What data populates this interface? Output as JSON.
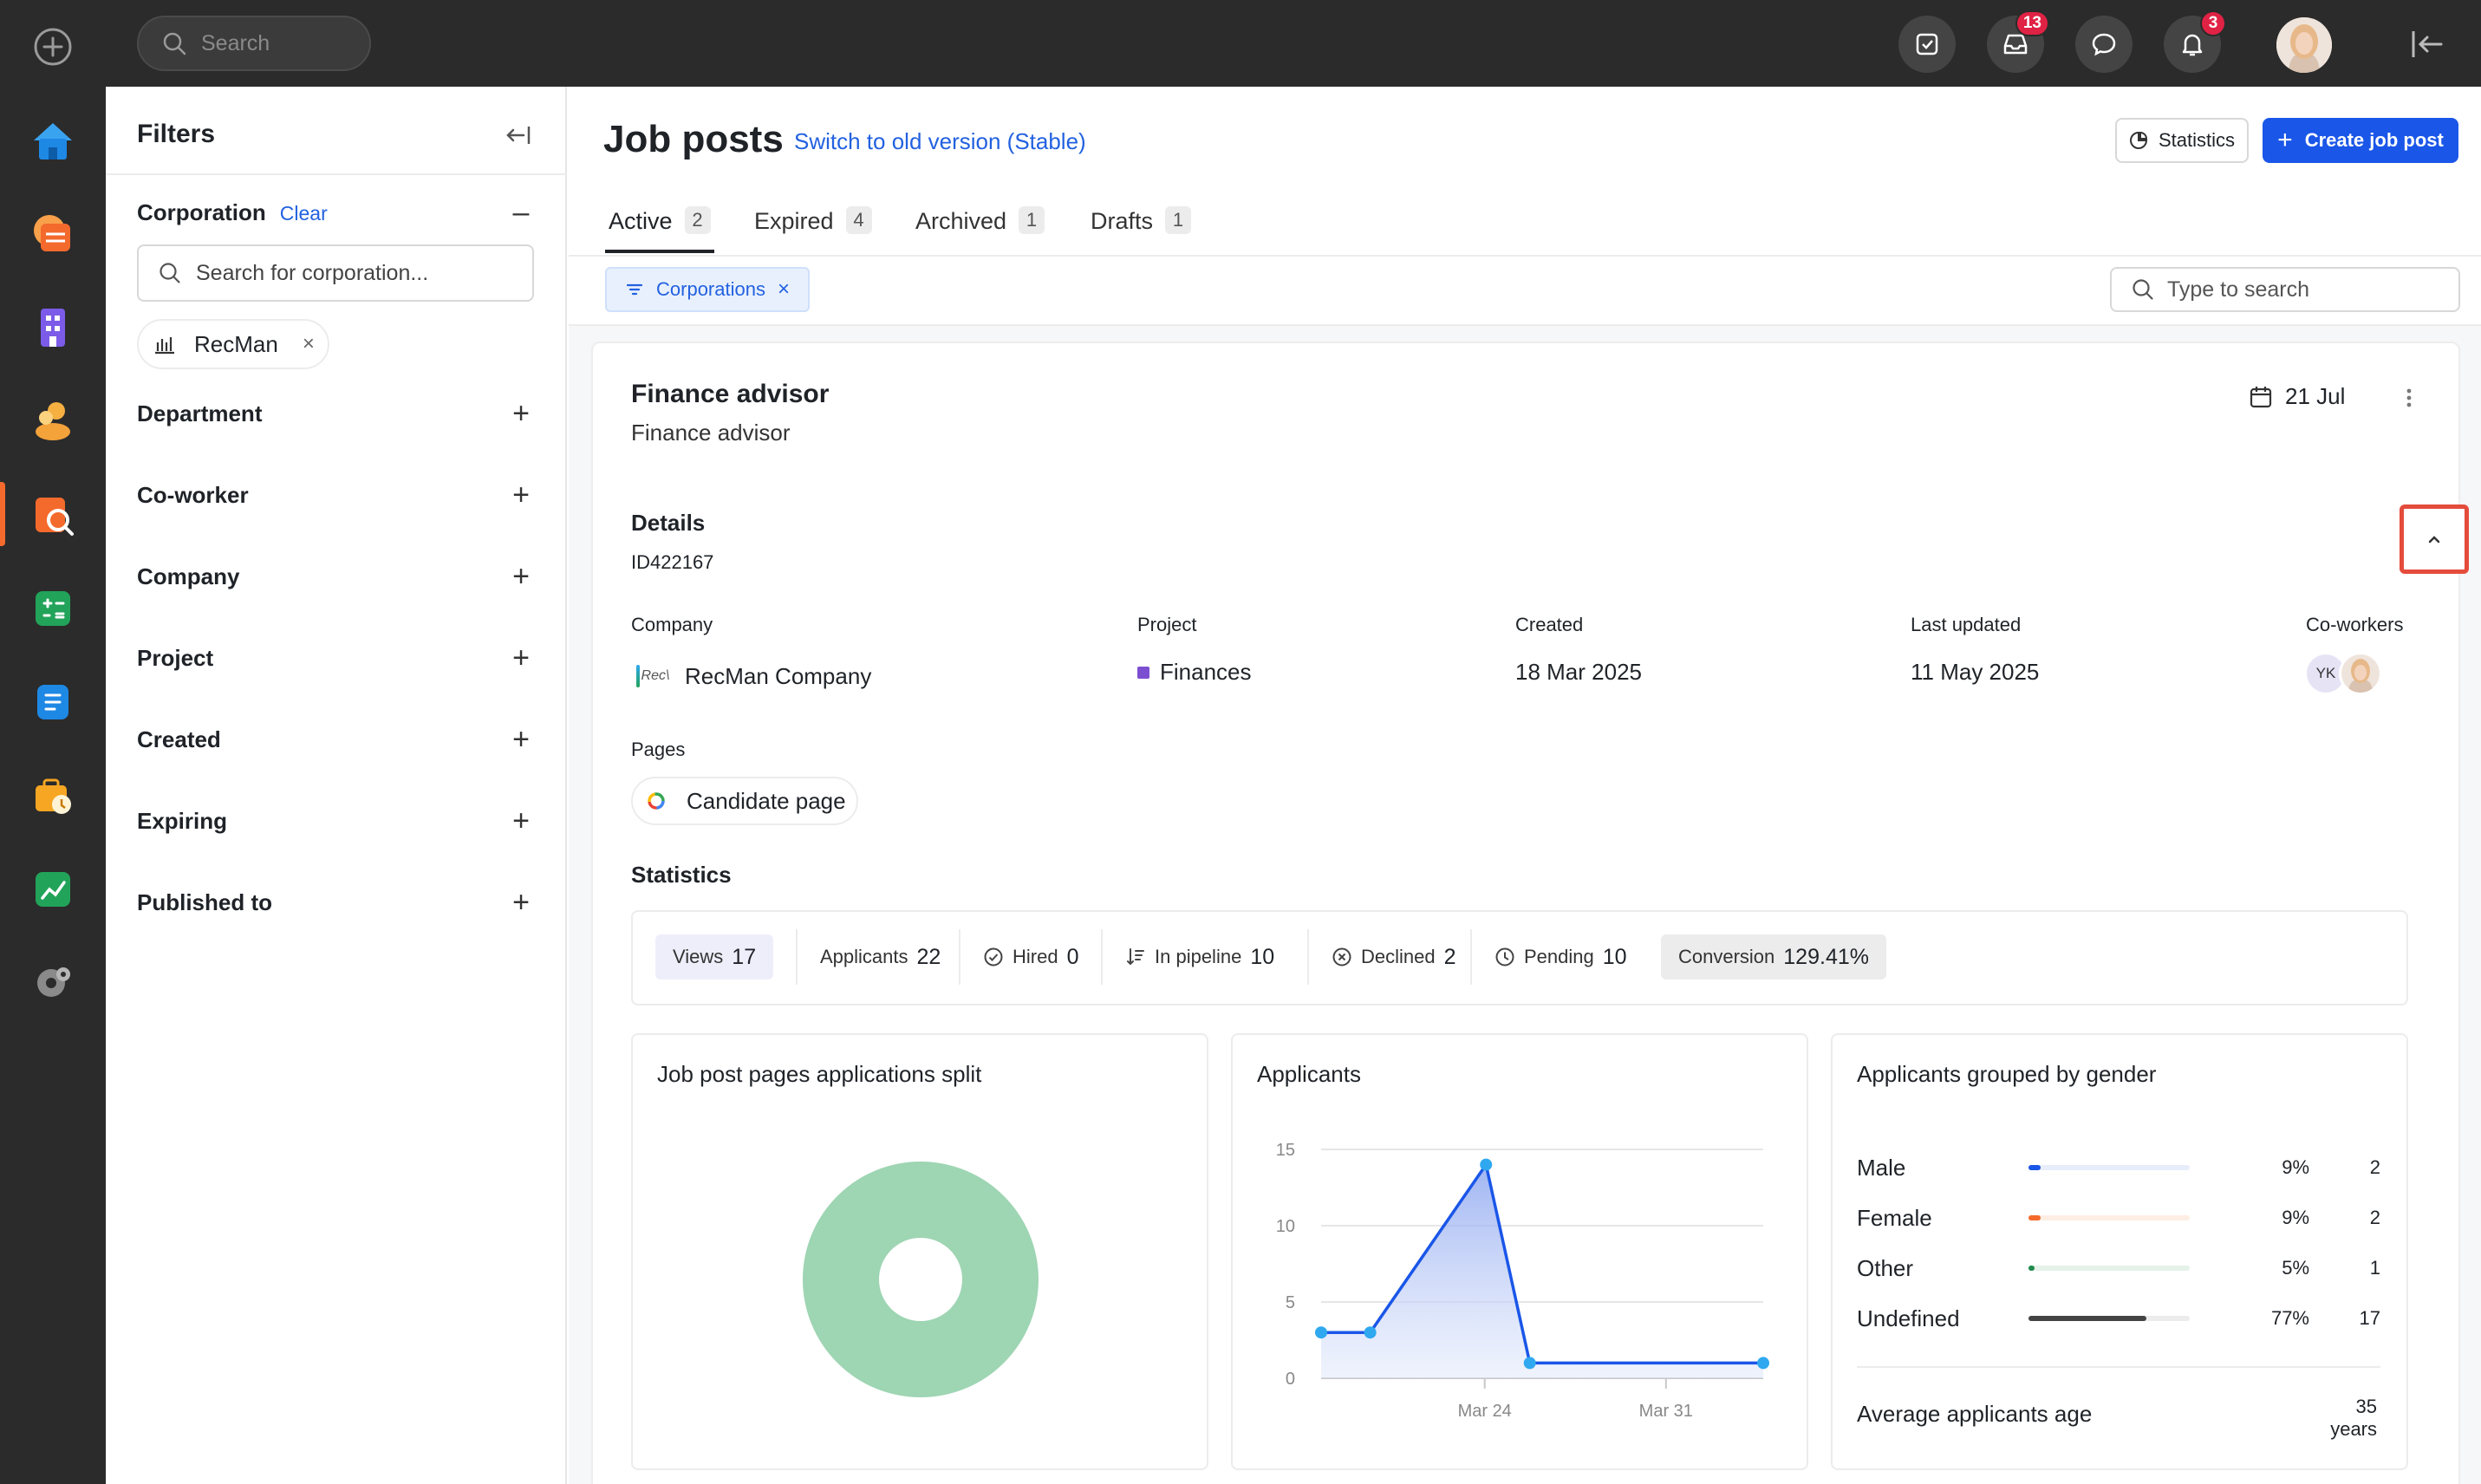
{
  "topbar": {
    "search_placeholder": "Search",
    "inbox_badge": "13",
    "notifications_badge": "3"
  },
  "filters": {
    "title": "Filters",
    "corporation": {
      "label": "Corporation",
      "clear": "Clear",
      "search_placeholder": "Search for corporation...",
      "chip": "RecMan"
    },
    "groups": [
      "Department",
      "Co-worker",
      "Company",
      "Project",
      "Created",
      "Expiring",
      "Published to"
    ]
  },
  "header": {
    "title": "Job posts",
    "old_version": "Switch to old version (Stable)",
    "statistics_button": "Statistics",
    "create_button": "Create job post",
    "tabs": [
      {
        "label": "Active",
        "count": "2"
      },
      {
        "label": "Expired",
        "count": "4"
      },
      {
        "label": "Archived",
        "count": "1"
      },
      {
        "label": "Drafts",
        "count": "1"
      }
    ],
    "filter_chip": "Corporations",
    "type_search_placeholder": "Type to search"
  },
  "job": {
    "title": "Finance advisor",
    "subtitle": "Finance advisor",
    "date": "21 Jul",
    "details_label": "Details",
    "id": "ID422167",
    "company_label": "Company",
    "company_logo_text": "Rec\\",
    "company": "RecMan Company",
    "project_label": "Project",
    "project": "Finances",
    "created_label": "Created",
    "created": "18 Mar 2025",
    "updated_label": "Last updated",
    "updated": "11 May 2025",
    "coworkers_label": "Co-workers",
    "coworker_initials": "YK",
    "pages_label": "Pages",
    "candidate_page": "Candidate page",
    "statistics_label": "Statistics"
  },
  "stats": {
    "views_label": "Views",
    "views": "17",
    "applicants_label": "Applicants",
    "applicants": "22",
    "hired_label": "Hired",
    "hired": "0",
    "pipeline_label": "In pipeline",
    "pipeline": "10",
    "declined_label": "Declined",
    "declined": "2",
    "pending_label": "Pending",
    "pending": "10",
    "conversion_label": "Conversion",
    "conversion": "129.41%"
  },
  "panels": {
    "split_title": "Job post pages applications split",
    "applicants_title": "Applicants",
    "gender_title": "Applicants grouped by gender",
    "avg_age_label": "Average applicants age",
    "avg_age_value": "35 years"
  },
  "colors": {
    "accent": "#1a56e8",
    "donut": "#9ed5b3",
    "line": "#1a56e8",
    "point": "#2fa8f0",
    "male": "#1a56e8",
    "female": "#f46a2c",
    "other": "#1f8a4c",
    "undefined": "#444444"
  },
  "chart_data": [
    {
      "type": "pie",
      "title": "Job post pages applications split",
      "values": [
        100
      ],
      "donut": true
    },
    {
      "type": "area",
      "title": "Applicants",
      "x_ticks": [
        "Mar 24",
        "Mar 31"
      ],
      "y_ticks": [
        0,
        5,
        10,
        15
      ],
      "ylim": [
        0,
        15
      ],
      "points": [
        3,
        3,
        14,
        1,
        1
      ],
      "x_positions": [
        0,
        0.111,
        0.373,
        0.472,
        1.0
      ]
    },
    {
      "type": "bar",
      "title": "Applicants grouped by gender",
      "categories": [
        "Male",
        "Female",
        "Other",
        "Undefined"
      ],
      "percent": [
        "9%",
        "9%",
        "5%",
        "77%"
      ],
      "percent_values": [
        9,
        9,
        5,
        77
      ],
      "counts": [
        "2",
        "2",
        "1",
        "17"
      ]
    }
  ]
}
